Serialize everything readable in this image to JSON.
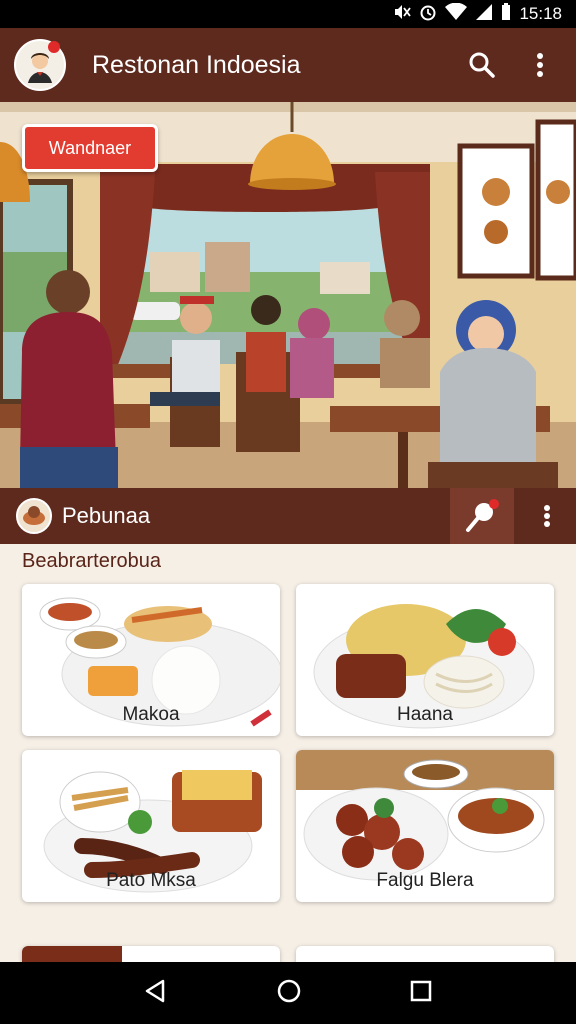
{
  "status": {
    "time": "15:18"
  },
  "app_bar": {
    "title": "Restonan Indoesia"
  },
  "hero": {
    "badge_label": "Wandnaer"
  },
  "section": {
    "title": "Pebunaa"
  },
  "content": {
    "subheading": "Beabrarterobua",
    "cards": [
      {
        "label": "Makoa"
      },
      {
        "label": "Haana"
      },
      {
        "label": "Pato Mksa"
      },
      {
        "label": "Falgu Blera"
      }
    ]
  },
  "colors": {
    "brand": "#5e2a1e",
    "accent": "#e23b30",
    "background": "#f5efe6"
  },
  "icons": [
    "mute-icon",
    "alarm-icon",
    "wifi-icon",
    "signal-icon",
    "search-icon",
    "more-vert-icon",
    "pin-icon",
    "back-icon",
    "home-icon",
    "recents-icon"
  ]
}
